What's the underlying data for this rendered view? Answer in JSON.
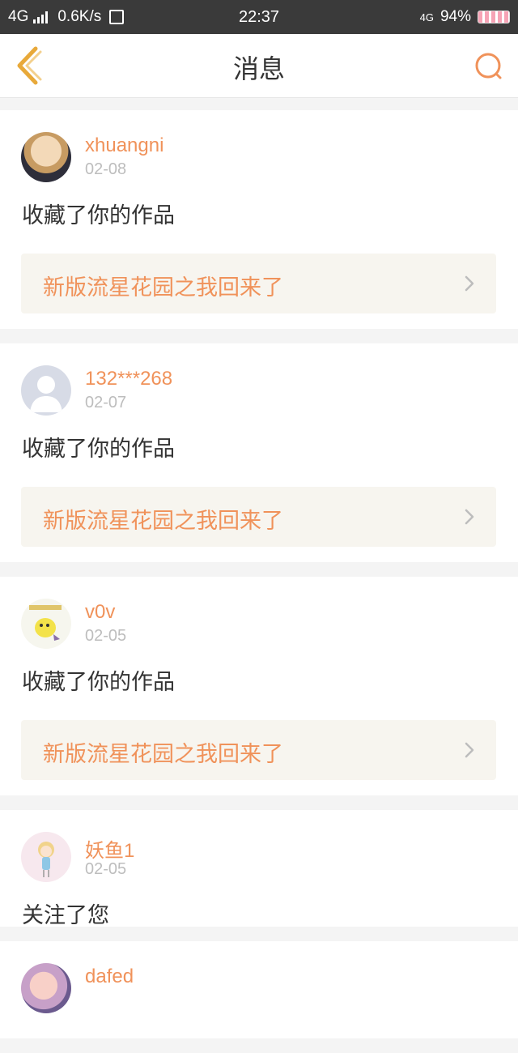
{
  "status_bar": {
    "network": "4G",
    "speed": "0.6K/s",
    "time": "22:37",
    "network_right": "4G",
    "battery": "94%"
  },
  "header": {
    "title": "消息"
  },
  "messages": [
    {
      "user": "xhuangni",
      "date": "02-08",
      "action": "收藏了你的作品",
      "work": "新版流星花园之我回来了",
      "avatar": "photo-avatar"
    },
    {
      "user": "132***268",
      "date": "02-07",
      "action": "收藏了你的作品",
      "work": "新版流星花园之我回来了",
      "avatar": "default-avatar"
    },
    {
      "user": "v0v",
      "date": "02-05",
      "action": "收藏了你的作品",
      "work": "新版流星花园之我回来了",
      "avatar": "cartoon-avatar"
    },
    {
      "user": "妖鱼1",
      "date": "02-05",
      "action": "关注了您",
      "avatar": "doll-avatar"
    },
    {
      "user": "dafed",
      "date": "",
      "action": "",
      "avatar": "photo-avatar"
    }
  ],
  "colors": {
    "accent": "#f0925a",
    "back_icon": "#e8a93a",
    "search_icon": "#f0925a"
  }
}
